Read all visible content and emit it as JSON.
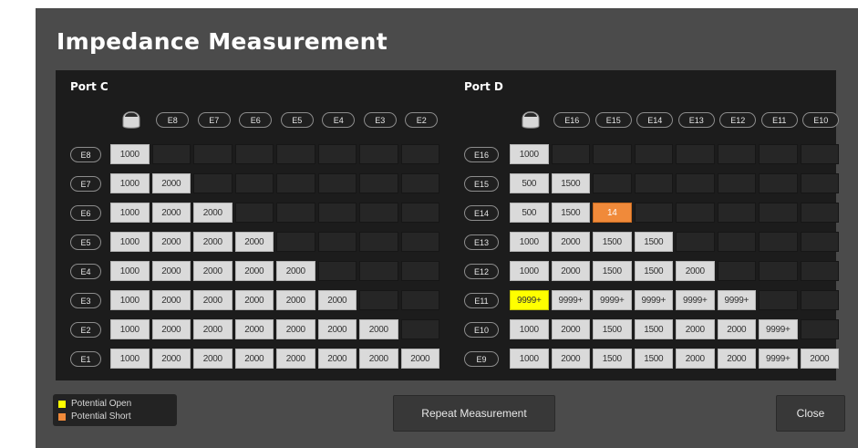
{
  "dialog": {
    "title": "Impedance Measurement",
    "repeat_label": "Repeat Measurement",
    "close_label": "Close"
  },
  "legend": {
    "items": [
      {
        "label": "Potential Open",
        "color": "#ffff00"
      },
      {
        "label": "Potential Short",
        "color": "#f08a3a"
      }
    ]
  },
  "ports": [
    {
      "name": "Port C",
      "ref_icon": "reference-electrode-icon",
      "columns": [
        "E8",
        "E7",
        "E6",
        "E5",
        "E4",
        "E3",
        "E2"
      ],
      "rows": [
        {
          "label": "E8",
          "values": [
            "1000"
          ]
        },
        {
          "label": "E7",
          "values": [
            "1000",
            "2000"
          ]
        },
        {
          "label": "E6",
          "values": [
            "1000",
            "2000",
            "2000"
          ]
        },
        {
          "label": "E5",
          "values": [
            "1000",
            "2000",
            "2000",
            "2000"
          ]
        },
        {
          "label": "E4",
          "values": [
            "1000",
            "2000",
            "2000",
            "2000",
            "2000"
          ]
        },
        {
          "label": "E3",
          "values": [
            "1000",
            "2000",
            "2000",
            "2000",
            "2000",
            "2000"
          ]
        },
        {
          "label": "E2",
          "values": [
            "1000",
            "2000",
            "2000",
            "2000",
            "2000",
            "2000",
            "2000"
          ]
        },
        {
          "label": "E1",
          "values": [
            "1000",
            "2000",
            "2000",
            "2000",
            "2000",
            "2000",
            "2000",
            "2000"
          ]
        }
      ],
      "flags": {}
    },
    {
      "name": "Port D",
      "ref_icon": "reference-electrode-icon",
      "columns": [
        "E16",
        "E15",
        "E14",
        "E13",
        "E12",
        "E11",
        "E10"
      ],
      "rows": [
        {
          "label": "E16",
          "values": [
            "1000"
          ]
        },
        {
          "label": "E15",
          "values": [
            "500",
            "1500"
          ]
        },
        {
          "label": "E14",
          "values": [
            "500",
            "1500",
            "14"
          ]
        },
        {
          "label": "E13",
          "values": [
            "1000",
            "2000",
            "1500",
            "1500"
          ]
        },
        {
          "label": "E12",
          "values": [
            "1000",
            "2000",
            "1500",
            "1500",
            "2000"
          ]
        },
        {
          "label": "E11",
          "values": [
            "9999+",
            "9999+",
            "9999+",
            "9999+",
            "9999+",
            "9999+"
          ]
        },
        {
          "label": "E10",
          "values": [
            "1000",
            "2000",
            "1500",
            "1500",
            "2000",
            "2000",
            "9999+"
          ]
        },
        {
          "label": "E9",
          "values": [
            "1000",
            "2000",
            "1500",
            "1500",
            "2000",
            "2000",
            "9999+",
            "2000"
          ]
        }
      ],
      "flags": {
        "5-0": "open",
        "2-2": "short"
      }
    }
  ]
}
